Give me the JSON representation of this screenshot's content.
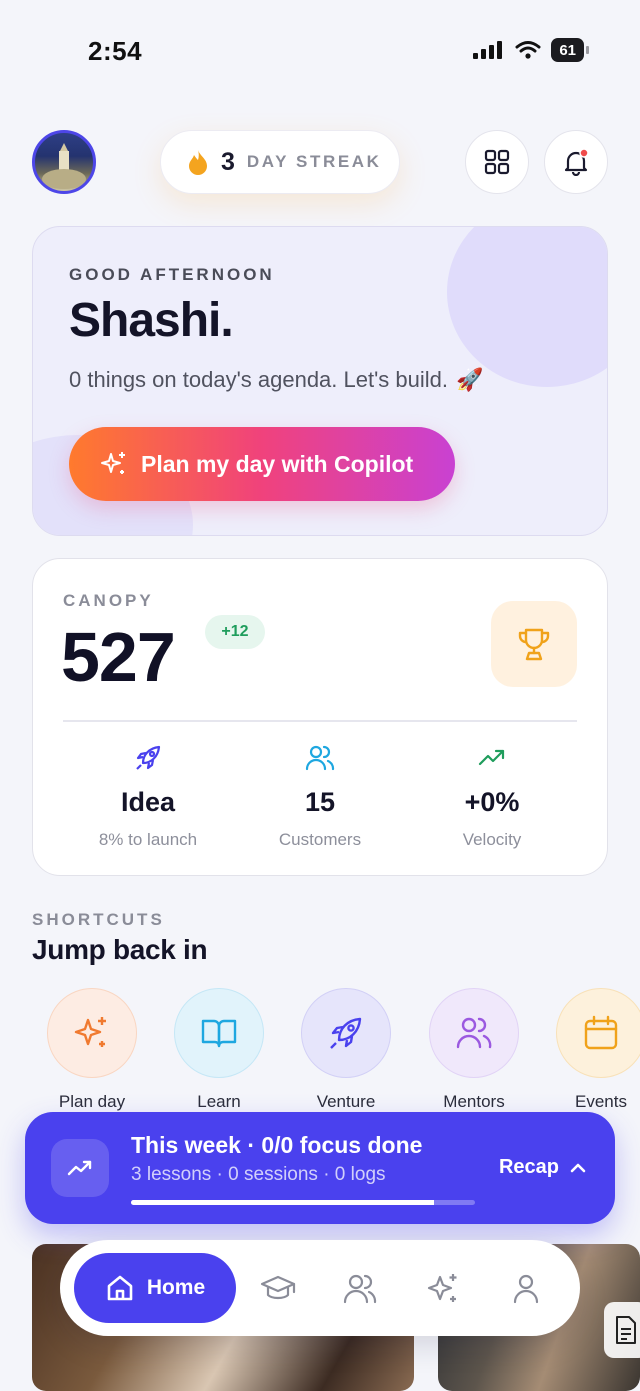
{
  "status_bar": {
    "time": "2:54",
    "battery": "61"
  },
  "header": {
    "streak_count": "3",
    "streak_label": "DAY STREAK"
  },
  "greeting": {
    "eyebrow": "GOOD AFTERNOON",
    "name": "Shashi.",
    "subtitle": "0 things on today's agenda. Let's build.",
    "emoji": "🚀",
    "cta_label": "Plan my day with Copilot"
  },
  "canopy": {
    "label": "CANOPY",
    "value": "527",
    "delta": "+12",
    "stats": [
      {
        "icon": "rocket-icon",
        "value": "Idea",
        "label": "8% to launch",
        "color": "#4a41ee"
      },
      {
        "icon": "users-icon",
        "value": "15",
        "label": "Customers",
        "color": "#1ea7e0"
      },
      {
        "icon": "trending-up-icon",
        "value": "+0%",
        "label": "Velocity",
        "color": "#1f9d5c"
      }
    ]
  },
  "shortcuts": {
    "eyebrow": "SHORTCUTS",
    "title": "Jump back in",
    "items": [
      {
        "label": "Plan day",
        "icon": "sparkle-icon"
      },
      {
        "label": "Learn",
        "icon": "book-icon"
      },
      {
        "label": "Venture",
        "icon": "rocket-icon"
      },
      {
        "label": "Mentors",
        "icon": "users-icon"
      },
      {
        "label": "Events",
        "icon": "calendar-icon"
      }
    ]
  },
  "week_bar": {
    "title": "This week · 0/0 focus done",
    "subtitle": "3 lessons · 0 sessions · 0 logs",
    "action": "Recap",
    "progress": 0.88
  },
  "tab_bar": {
    "home_label": "Home",
    "tabs": [
      "graduation-cap-icon",
      "users-icon",
      "sparkle-icon",
      "profile-icon"
    ]
  },
  "colors": {
    "accent": "#4a41ee",
    "streak_flame": "#f4a41f",
    "cta_gradient": [
      "#ff7a2d",
      "#f0427c",
      "#c941d2"
    ],
    "delta_green": "#1f9d5c",
    "trophy": "#f0a21a"
  }
}
